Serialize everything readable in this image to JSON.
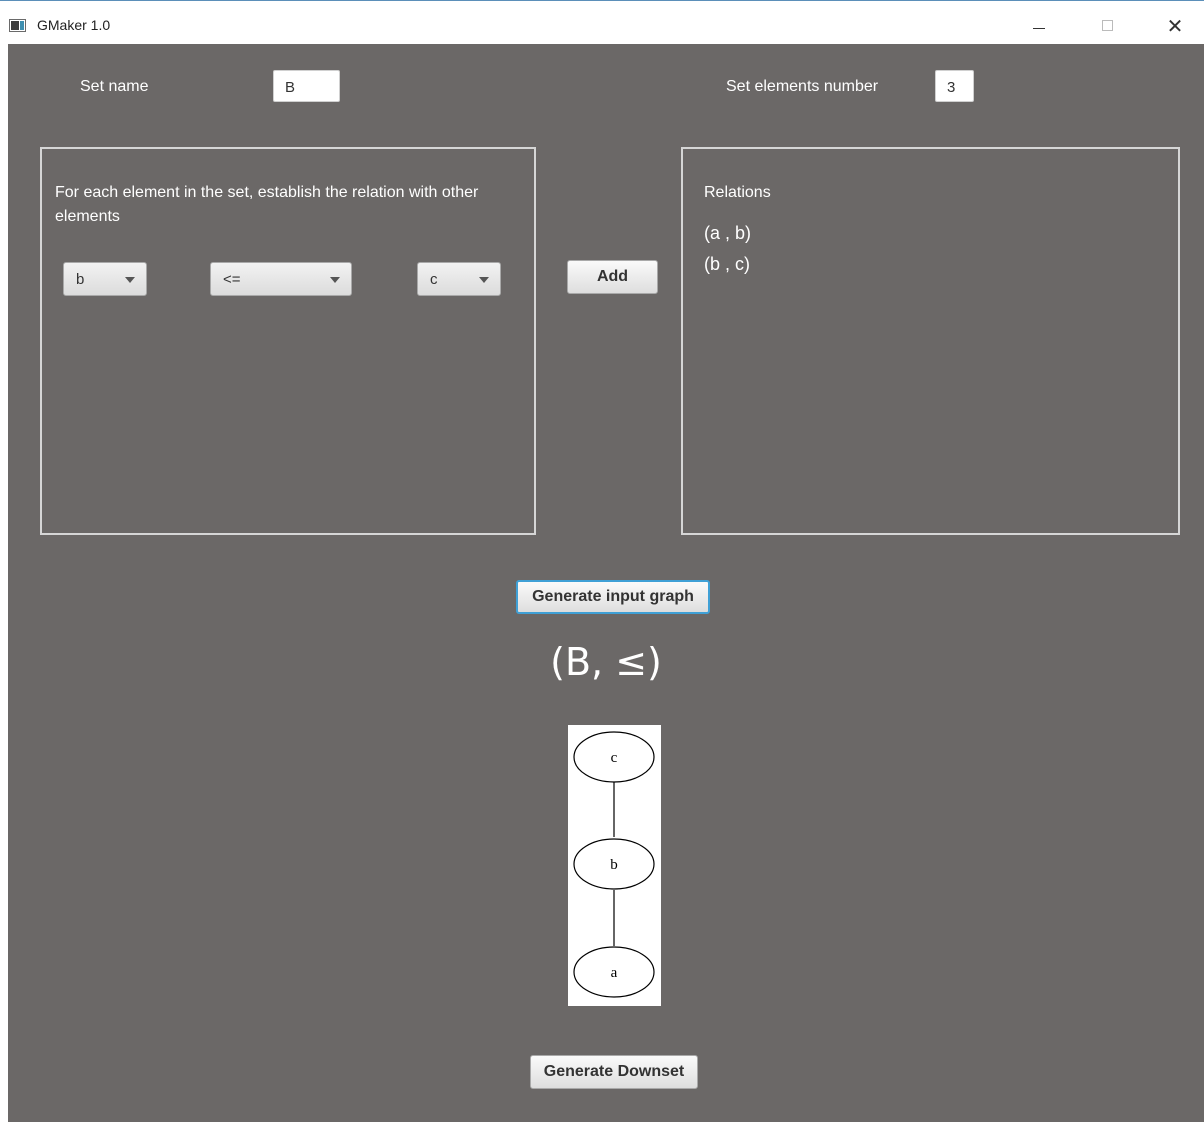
{
  "window": {
    "title": "GMaker 1.0",
    "minimize_glyph": "",
    "maximize_glyph": "",
    "close_glyph": "✕"
  },
  "form": {
    "set_name_label": "Set name",
    "set_name_value": "B",
    "set_elements_label": "Set elements number",
    "set_elements_value": "3"
  },
  "relation_panel": {
    "instruction": "For each element in the set, establish the relation with other elements",
    "left_element": "b",
    "operator": "<=",
    "right_element": "c",
    "add_button": "Add"
  },
  "relations_panel": {
    "title": "Relations",
    "items": [
      "(a , b)",
      "(b , c)"
    ]
  },
  "generate_graph_button": "Generate input graph",
  "poset_label": "(B, ≤)",
  "graph": {
    "nodes": [
      "c",
      "b",
      "a"
    ],
    "edges": [
      [
        "c",
        "b"
      ],
      [
        "b",
        "a"
      ]
    ]
  },
  "generate_downset_button": "Generate Downset",
  "colors": {
    "background": "#6b6867",
    "panel_border": "#d6d6d6",
    "focus_border": "#3fa0d6"
  }
}
